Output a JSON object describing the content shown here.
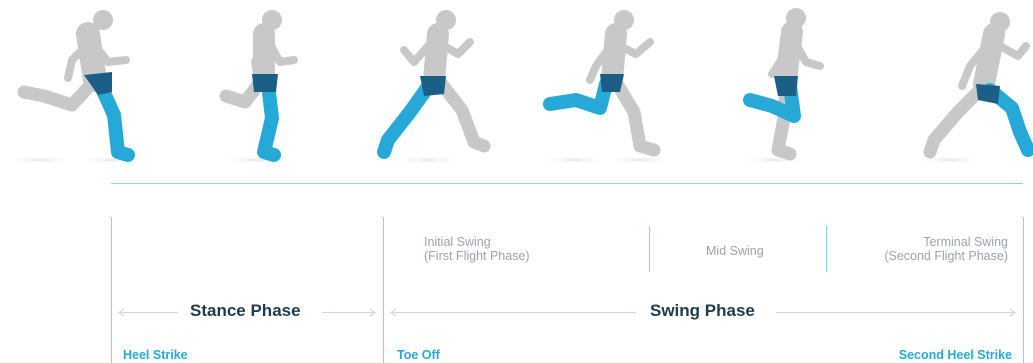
{
  "colors": {
    "accent": "#27a9d8",
    "line": "#8fd3ea",
    "figure": "#c8c8c8",
    "shorts": "#1c5f86",
    "phase_text": "#1f3b4d",
    "sub_text": "#9aa3ab"
  },
  "sub_phases": {
    "initial_swing": [
      "Initial Swing",
      "(First Flight Phase)"
    ],
    "mid_swing": "Mid Swing",
    "terminal_swing": [
      "Terminal Swing",
      "(Second Flight Phase)"
    ]
  },
  "phases": {
    "stance": "Stance Phase",
    "swing": "Swing Phase"
  },
  "events": {
    "heel_strike": "Heel Strike",
    "toe_off": "Toe Off",
    "second_heel_strike": "Second Heel Strike"
  },
  "figures": [
    {
      "name": "runner-heel-strike"
    },
    {
      "name": "runner-loading"
    },
    {
      "name": "runner-toe-off"
    },
    {
      "name": "runner-initial-swing"
    },
    {
      "name": "runner-mid-swing"
    },
    {
      "name": "runner-terminal-swing"
    }
  ]
}
